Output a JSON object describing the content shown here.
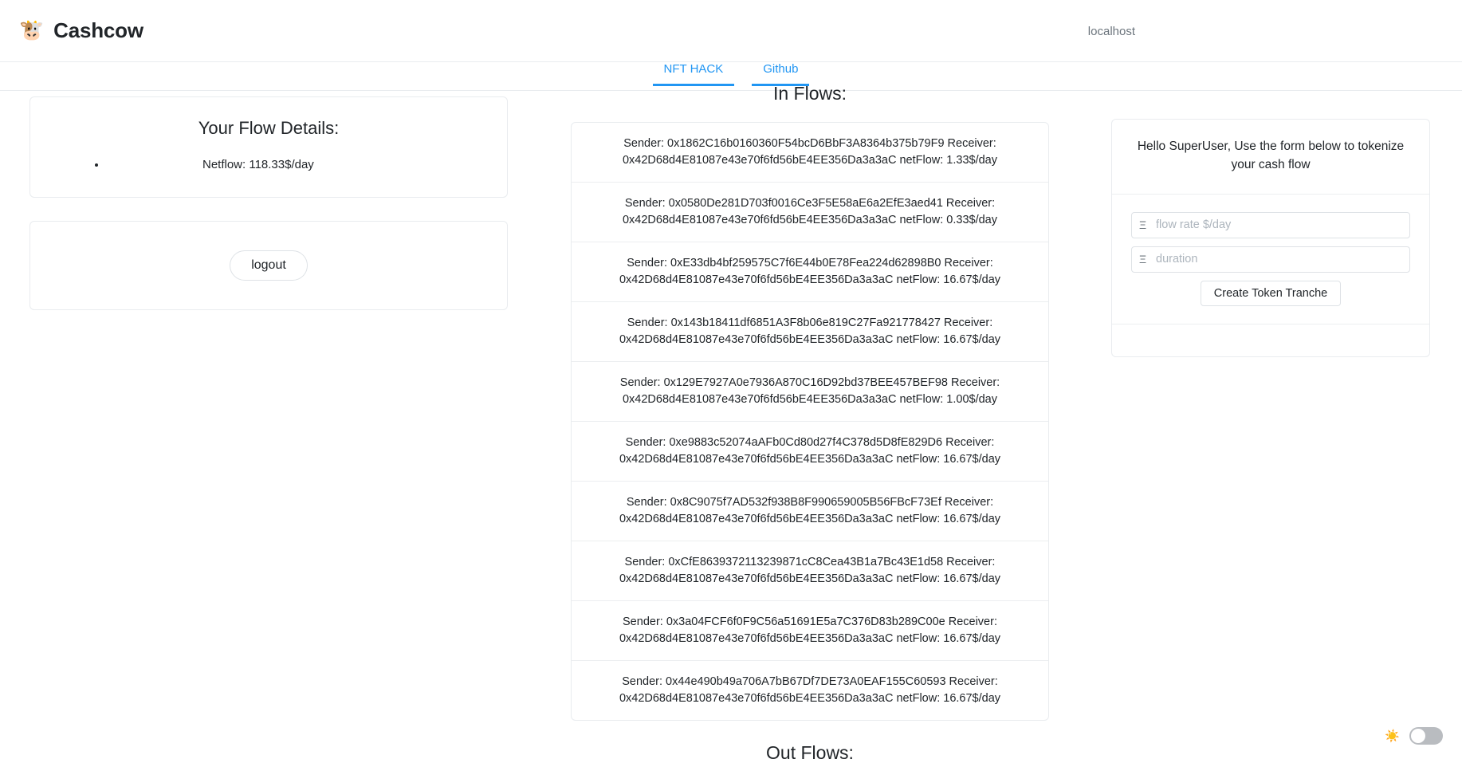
{
  "navbar": {
    "brand_emoji": "🐮",
    "brand_emoji_name": "cow-emoji",
    "brand_title": "Cashcow",
    "host_label": "localhost"
  },
  "tabs": [
    {
      "label": "NFT HACK",
      "active": true
    },
    {
      "label": "Github",
      "active": true
    }
  ],
  "left": {
    "flow_details": {
      "title": "Your Flow Details:",
      "items": [
        "Netflow: 118.33$/day"
      ]
    },
    "logout_label": "logout"
  },
  "center": {
    "in_flows_title": "In Flows:",
    "out_flows_title": "Out Flows:",
    "in_flows": [
      "Sender: 0x1862C16b0160360F54bcD6BbF3A8364b375b79F9 Receiver: 0x42D68d4E81087e43e70f6fd56bE4EE356Da3a3aC netFlow: 1.33$/day",
      "Sender: 0x0580De281D703f0016Ce3F5E58aE6a2EfE3aed41 Receiver: 0x42D68d4E81087e43e70f6fd56bE4EE356Da3a3aC netFlow: 0.33$/day",
      "Sender: 0xE33db4bf259575C7f6E44b0E78Fea224d62898B0 Receiver: 0x42D68d4E81087e43e70f6fd56bE4EE356Da3a3aC netFlow: 16.67$/day",
      "Sender: 0x143b18411df6851A3F8b06e819C27Fa921778427 Receiver: 0x42D68d4E81087e43e70f6fd56bE4EE356Da3a3aC netFlow: 16.67$/day",
      "Sender: 0x129E7927A0e7936A870C16D92bd37BEE457BEF98 Receiver: 0x42D68d4E81087e43e70f6fd56bE4EE356Da3a3aC netFlow: 1.00$/day",
      "Sender: 0xe9883c52074aAFb0Cd80d27f4C378d5D8fE829D6 Receiver: 0x42D68d4E81087e43e70f6fd56bE4EE356Da3a3aC netFlow: 16.67$/day",
      "Sender: 0x8C9075f7AD532f938B8F990659005B56FBcF73Ef Receiver: 0x42D68d4E81087e43e70f6fd56bE4EE356Da3a3aC netFlow: 16.67$/day",
      "Sender: 0xCfE8639372113239871cC8Cea43B1a7Bc43E1d58 Receiver: 0x42D68d4E81087e43e70f6fd56bE4EE356Da3a3aC netFlow: 16.67$/day",
      "Sender: 0x3a04FCF6f0F9C56a51691E5a7C376D83b289C00e Receiver: 0x42D68d4E81087e43e70f6fd56bE4EE356Da3a3aC netFlow: 16.67$/day",
      "Sender: 0x44e490b49a706A7bB67Df7DE73A0EAF155C60593 Receiver: 0x42D68d4E81087e43e70f6fd56bE4EE356Da3a3aC netFlow: 16.67$/day"
    ]
  },
  "right": {
    "greeting": "Hello SuperUser, Use the form below to tokenize your cash flow",
    "flow_rate_prefix": "Ξ",
    "flow_rate_placeholder": "flow rate $/day",
    "flow_rate_value": "",
    "duration_prefix": "Ξ",
    "duration_placeholder": "duration",
    "duration_value": "",
    "create_label": "Create Token Tranche"
  },
  "theme": {
    "sun_icon": "☀️",
    "toggle_on": false
  },
  "colors": {
    "accent": "#2196f3",
    "border": "#e9ecef",
    "muted_text": "#6c757d",
    "toggle_track": "#b9bcc0"
  }
}
